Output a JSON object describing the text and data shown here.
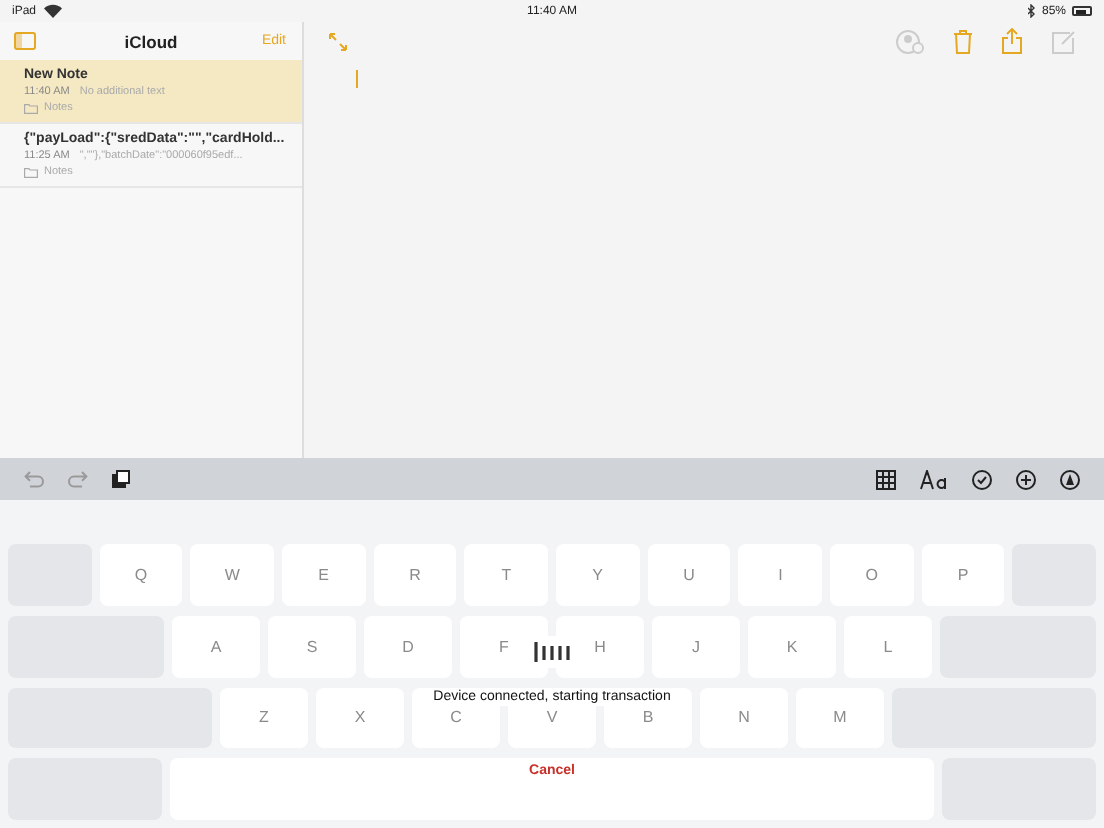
{
  "status_bar": {
    "device": "iPad",
    "time": "11:40 AM",
    "battery": "85%"
  },
  "sidebar": {
    "title": "iCloud",
    "edit": "Edit",
    "notes": [
      {
        "title": "New Note",
        "time": "11:40 AM",
        "preview": "No additional text",
        "folder": "Notes",
        "selected": true
      },
      {
        "title": "{\"payLoad\":{\"sredData\":\"\",\"cardHold...",
        "time": "11:25 AM",
        "preview": "\",\"\"},\"batchDate\":\"000060f95edf...",
        "folder": "Notes",
        "selected": false
      }
    ]
  },
  "keyboard": {
    "rows": [
      [
        "Q",
        "W",
        "E",
        "R",
        "T",
        "Y",
        "U",
        "I",
        "O",
        "P"
      ],
      [
        "A",
        "S",
        "D",
        "F",
        "H",
        "J",
        "K",
        "L"
      ],
      [
        "Z",
        "X",
        "C",
        "V",
        "B",
        "N",
        "M"
      ]
    ]
  },
  "reader_dialog": {
    "message": "Device connected, starting transaction",
    "cancel": "Cancel"
  }
}
